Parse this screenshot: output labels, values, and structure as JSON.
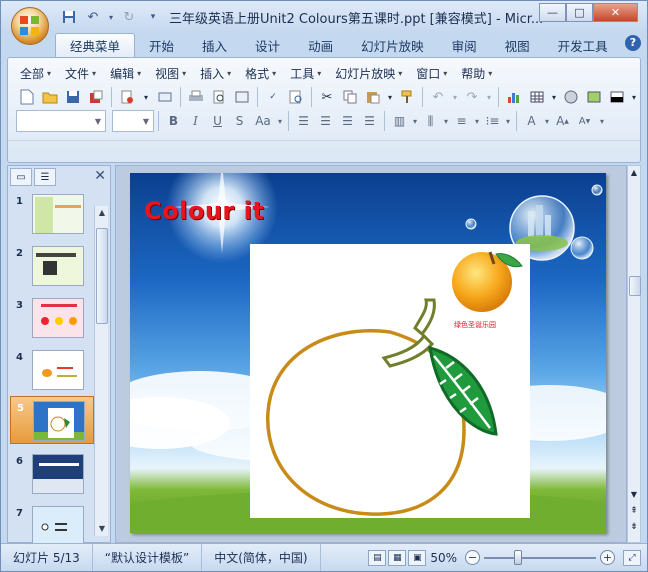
{
  "window": {
    "title": "三年级英语上册Unit2 Colours第五课时.ppt [兼容模式] - Micr...",
    "controls": {
      "minimize": "—",
      "maximize": "□",
      "close": "✕"
    }
  },
  "ribbon_tabs": [
    "经典菜单",
    "开始",
    "插入",
    "设计",
    "动画",
    "幻灯片放映",
    "审阅",
    "视图",
    "开发工具"
  ],
  "active_tab": "经典菜单",
  "help_label": "?",
  "menu_bar": [
    "全部",
    "文件",
    "编辑",
    "视图",
    "插入",
    "格式",
    "工具",
    "幻灯片放映",
    "窗口",
    "帮助"
  ],
  "format_buttons": {
    "bold": "B",
    "italic": "I",
    "underline": "U",
    "strike": "S",
    "font_case": "Aa",
    "font_color": "A"
  },
  "slides_panel": {
    "close_label": "✕",
    "slides": [
      {
        "number": "1"
      },
      {
        "number": "2"
      },
      {
        "number": "3"
      },
      {
        "number": "4"
      },
      {
        "number": "5",
        "selected": true
      },
      {
        "number": "6"
      },
      {
        "number": "7"
      }
    ]
  },
  "slide": {
    "title": "Colour it",
    "watermark": "绿色圣诞乐园"
  },
  "status_bar": {
    "slide_info": "幻灯片 5/13",
    "theme": "“默认设计模板”",
    "language": "中文(简体，中国)",
    "zoom": "50%"
  },
  "colors": {
    "accent": "#2f63b0",
    "selected_slide": "#e89a3c",
    "title_red": "#e8141e"
  }
}
